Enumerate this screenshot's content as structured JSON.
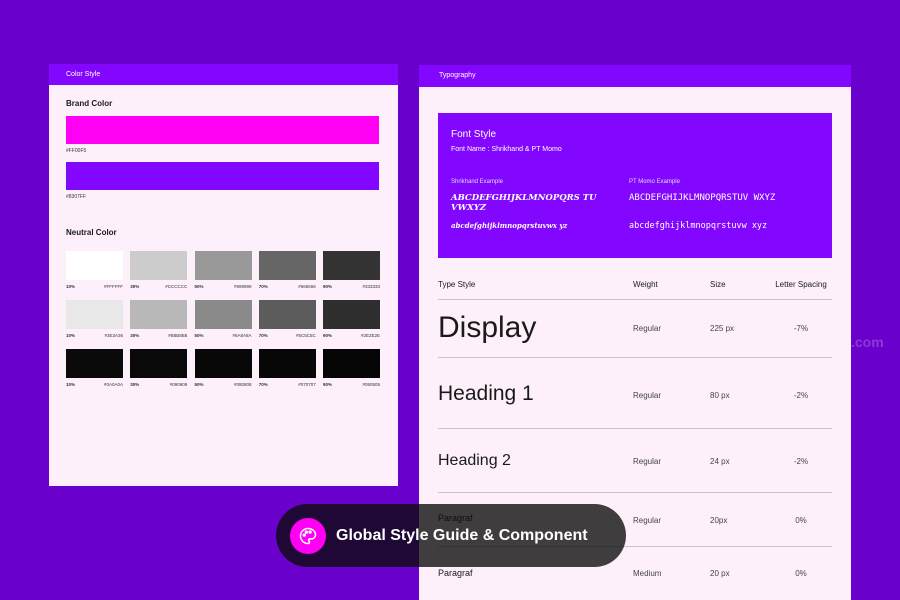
{
  "color_panel": {
    "header": "Color Style",
    "brand_title": "Brand Color",
    "brand_colors": [
      {
        "hex": "#FF00F5",
        "label": "#FF00F5"
      },
      {
        "hex": "#8307FF",
        "label": "#8307FF"
      }
    ],
    "neutral_title": "Neutral Color",
    "neutral_rows": [
      [
        {
          "pct": "10%",
          "hex": "#FFFFFF",
          "color": "#ffffff"
        },
        {
          "pct": "30%",
          "hex": "#CCCCCC",
          "color": "#cccccc"
        },
        {
          "pct": "50%",
          "hex": "#999999",
          "color": "#999999"
        },
        {
          "pct": "70%",
          "hex": "#666666",
          "color": "#666666"
        },
        {
          "pct": "90%",
          "hex": "#333333",
          "color": "#333333"
        }
      ],
      [
        {
          "pct": "10%",
          "hex": "#3E3A36",
          "color": "#e8e8e8"
        },
        {
          "pct": "30%",
          "hex": "#B8B8B8",
          "color": "#b8b8b8"
        },
        {
          "pct": "50%",
          "hex": "#8A8A8A",
          "color": "#8a8a8a"
        },
        {
          "pct": "70%",
          "hex": "#5C5C5C",
          "color": "#5c5c5c"
        },
        {
          "pct": "90%",
          "hex": "#2E2E2E",
          "color": "#2e2e2e"
        }
      ],
      [
        {
          "pct": "10%",
          "hex": "#0A0A0A",
          "color": "#0a0a0a"
        },
        {
          "pct": "30%",
          "hex": "#090909",
          "color": "#090909"
        },
        {
          "pct": "50%",
          "hex": "#080808",
          "color": "#080808"
        },
        {
          "pct": "70%",
          "hex": "#070707",
          "color": "#070707"
        },
        {
          "pct": "90%",
          "hex": "#050505",
          "color": "#050505"
        }
      ]
    ]
  },
  "typo_panel": {
    "header": "Typography",
    "font_box": {
      "title": "Font Style",
      "font_name": "Font Name : Shrikhand & PT Momo",
      "shrikhand_label": "Shrikhand Example",
      "shrikhand_upper": "ABCDEFGHIJKLMNOPQRS TUVWXYZ",
      "shrikhand_lower": "abcdefghijklmnopqrstuvwx yz",
      "momo_label": "PT Momo Example",
      "momo_upper": "ABCDEFGHIJKLMNOPQRSTUV WXYZ",
      "momo_lower": "abcdefghijklmnopqrstuvw xyz"
    },
    "table_header": {
      "type_style": "Type Style",
      "weight": "Weight",
      "size": "Size",
      "letter_spacing": "Letter Spacing"
    },
    "rows": [
      {
        "style": "Display",
        "weight": "Regular",
        "size": "225 px",
        "spacing": "-7%"
      },
      {
        "style": "Heading 1",
        "weight": "Regular",
        "size": "80 px",
        "spacing": "-2%"
      },
      {
        "style": "Heading 2",
        "weight": "Regular",
        "size": "24 px",
        "spacing": "-2%"
      },
      {
        "style": "Paragraf",
        "weight": "Regular",
        "size": "20px",
        "spacing": "0%"
      },
      {
        "style": "Paragraf",
        "weight": "Medium",
        "size": "20 px",
        "spacing": "0%"
      }
    ]
  },
  "badge": {
    "icon": "palette-icon",
    "text": "Global Style Guide & Component"
  },
  "watermark": ".com",
  "colors": {
    "background": "#6a00cc",
    "brand_magenta": "#ff00f5",
    "brand_purple": "#8307ff",
    "panel_bg": "#fdf0fb"
  }
}
